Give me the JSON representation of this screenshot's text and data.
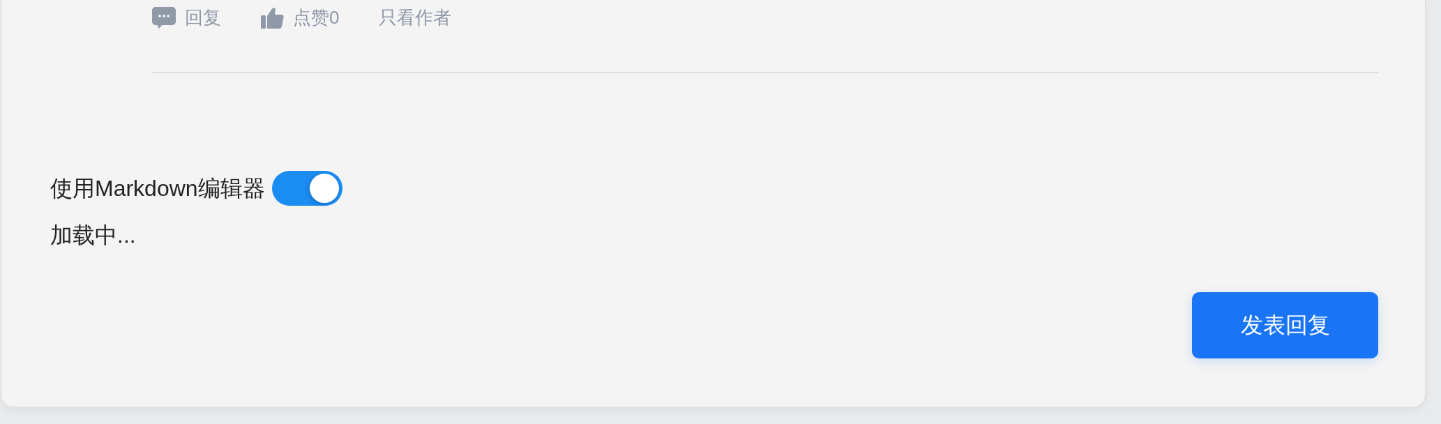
{
  "actions": [
    {
      "kind": "reply",
      "label": "回复"
    },
    {
      "kind": "like",
      "label": "点赞0"
    },
    {
      "kind": "author",
      "label": "只看作者"
    }
  ],
  "editor": {
    "markdown_toggle": {
      "label": "使用Markdown编辑器",
      "on": true
    },
    "status": "加载中..."
  },
  "submit_button": {
    "label": "发表回复"
  }
}
